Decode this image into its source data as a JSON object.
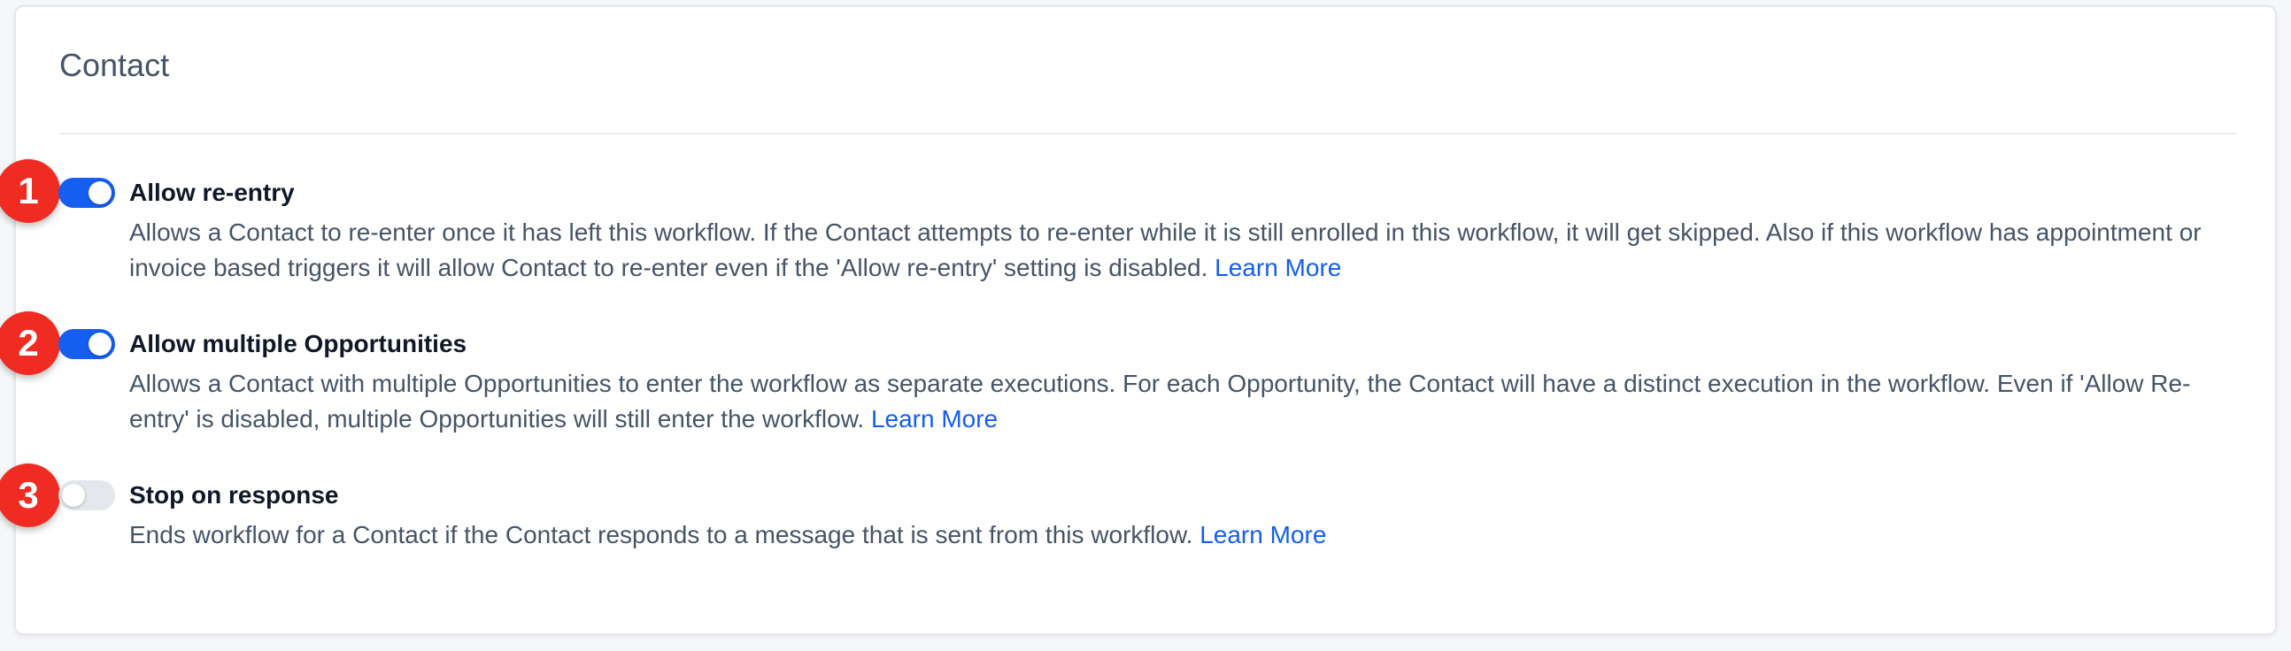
{
  "card": {
    "title": "Contact"
  },
  "settings": [
    {
      "badge": "1",
      "enabled": true,
      "title": "Allow re-entry",
      "description": "Allows a Contact to re-enter once it has left this workflow. If the Contact attempts to re-enter while it is still enrolled in this workflow, it will get skipped. Also if this workflow has appointment or invoice based triggers it will allow Contact to re-enter even if the 'Allow re-entry' setting is disabled.",
      "link": "Learn More"
    },
    {
      "badge": "2",
      "enabled": true,
      "title": "Allow multiple Opportunities",
      "description": "Allows a Contact with multiple Opportunities to enter the workflow as separate executions. For each Opportunity, the Contact will have a distinct execution in the workflow. Even if 'Allow Re-entry' is disabled, multiple Opportunities will still enter the workflow.",
      "link": "Learn More"
    },
    {
      "badge": "3",
      "enabled": false,
      "title": "Stop on response",
      "description": "Ends workflow for a Contact if the Contact responds to a message that is sent from this workflow.",
      "link": "Learn More"
    }
  ],
  "colors": {
    "toggle_on": "#155eef",
    "toggle_off": "#e4e7ec",
    "badge": "#ef2b22",
    "link": "#155eef"
  }
}
